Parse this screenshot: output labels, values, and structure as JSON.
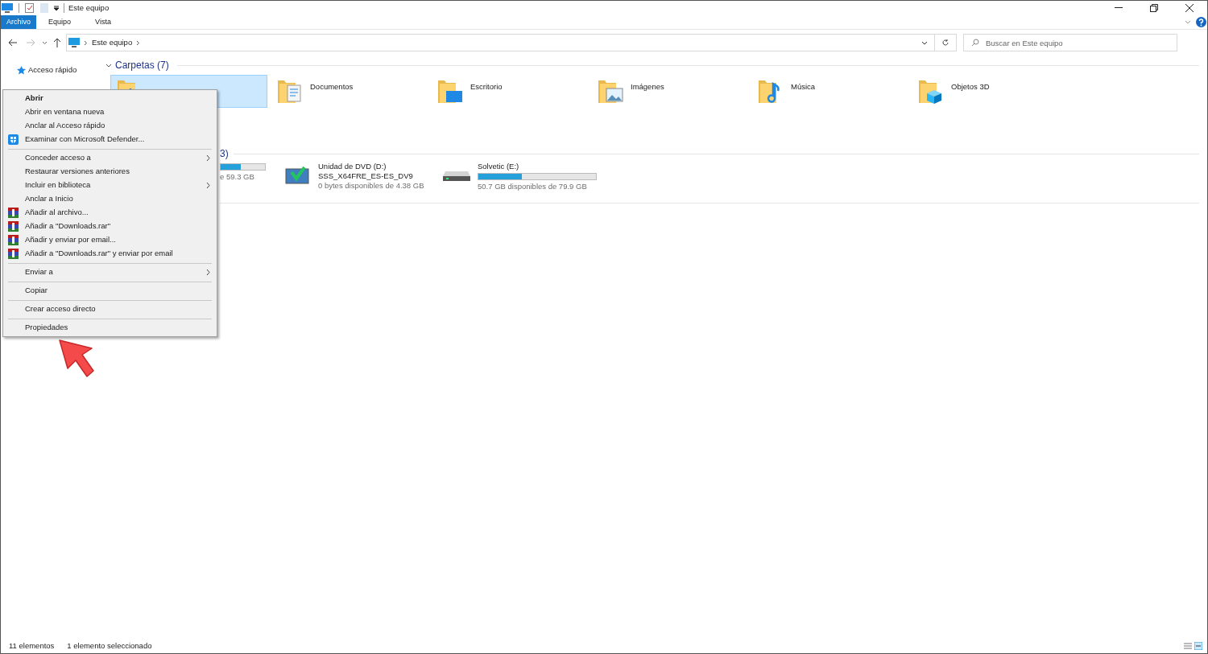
{
  "window": {
    "title": "Este equipo"
  },
  "ribbon_tabs": [
    {
      "label": "Archivo",
      "selected": true
    },
    {
      "label": "Equipo",
      "selected": false
    },
    {
      "label": "Vista",
      "selected": false
    }
  ],
  "address": {
    "crumbs": [
      "Este equipo"
    ]
  },
  "search": {
    "placeholder": "Buscar en Este equipo"
  },
  "sidebar": {
    "items": [
      {
        "label": "Acceso rápido"
      }
    ]
  },
  "folders": {
    "heading": "Carpetas (7)",
    "items": [
      {
        "kind": "downloads",
        "selected": true
      },
      {
        "kind": "documents",
        "name": "Documentos",
        "selected": false
      },
      {
        "kind": "desktop",
        "name": "Escritorio",
        "selected": false
      },
      {
        "kind": "pictures",
        "name": "Imágenes",
        "selected": false
      },
      {
        "kind": "music",
        "name": "Música",
        "selected": false
      },
      {
        "kind": "objects3d",
        "name": "Objetos 3D",
        "selected": false
      }
    ]
  },
  "devices": {
    "heading": "3)",
    "items": [
      {
        "kind": "partial",
        "level": 0.45,
        "lines": [
          "e 59.3 GB"
        ]
      },
      {
        "kind": "dvd",
        "lines": [
          "Unidad de DVD (D:)",
          "SSS_X64FRE_ES-ES_DV9",
          "0 bytes disponibles de 4.38 GB"
        ]
      },
      {
        "kind": "disk",
        "level": 0.37,
        "lines": [
          "Solvetic (E:)",
          "50.7 GB disponibles de 79.9 GB"
        ]
      }
    ]
  },
  "context_menu": {
    "items": [
      {
        "kind": "item",
        "label": "Abrir",
        "bold": true
      },
      {
        "kind": "item",
        "label": "Abrir en ventana nueva"
      },
      {
        "kind": "item",
        "label": "Anclar al Acceso rápido"
      },
      {
        "kind": "scan",
        "label": "Examinar con Microsoft Defender..."
      },
      {
        "kind": "separator"
      },
      {
        "kind": "item",
        "label": "Conceder acceso a",
        "submenu": true
      },
      {
        "kind": "item",
        "label": "Restaurar versiones anteriores"
      },
      {
        "kind": "item",
        "label": "Incluir en biblioteca",
        "submenu": true
      },
      {
        "kind": "item",
        "label": "Anclar a Inicio"
      },
      {
        "kind": "archive",
        "label": "Añadir al archivo..."
      },
      {
        "kind": "archive",
        "label": "Añadir a \"Downloads.rar\""
      },
      {
        "kind": "archive",
        "label": "Añadir y enviar por email..."
      },
      {
        "kind": "archive",
        "label": "Añadir a \"Downloads.rar\" y enviar por email"
      },
      {
        "kind": "separator"
      },
      {
        "kind": "item",
        "label": "Enviar a",
        "submenu": true
      },
      {
        "kind": "separator"
      },
      {
        "kind": "item",
        "label": "Copiar"
      },
      {
        "kind": "separator"
      },
      {
        "kind": "item",
        "label": "Crear acceso directo"
      },
      {
        "kind": "separator"
      },
      {
        "kind": "item",
        "label": "Propiedades"
      }
    ]
  },
  "status_bar": [
    "11 elementos",
    "1 elemento seleccionado"
  ]
}
